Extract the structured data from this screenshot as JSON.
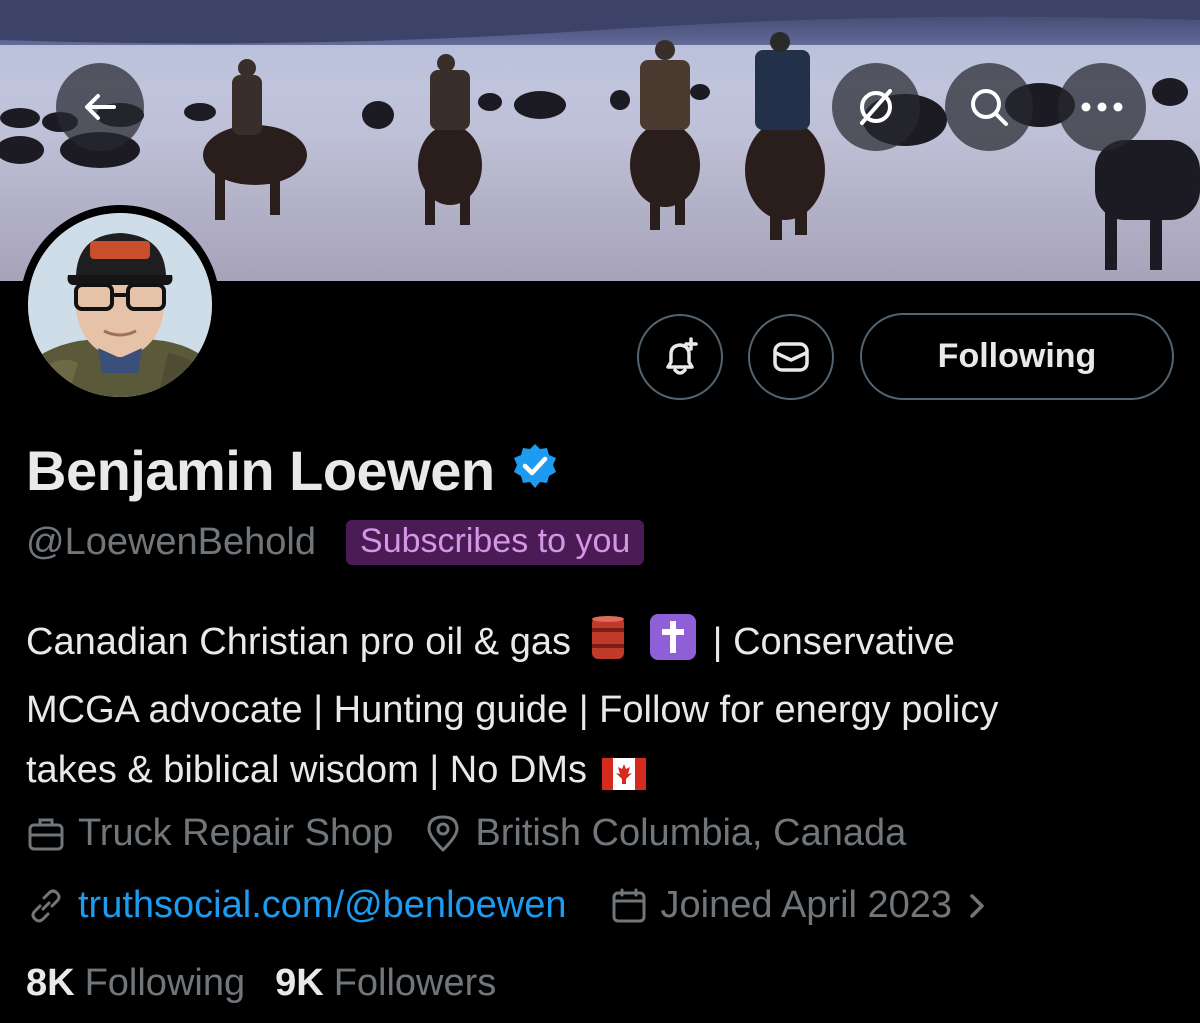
{
  "profile": {
    "name": "Benjamin Loewen",
    "handle": "@LoewenBehold",
    "subscribes_badge": "Subscribes to you",
    "bio": {
      "line1_a": "Canadian Christian pro oil & gas",
      "line1_b": "| Conservative",
      "line2": "MCGA advocate | Hunting guide | Follow for energy policy",
      "line3": "takes & biblical wisdom | No DMs"
    },
    "work": "Truck Repair Shop",
    "location": "British Columbia, Canada",
    "website": "truthsocial.com/@benloewen",
    "joined": "Joined April 2023"
  },
  "actions": {
    "follow_label": "Following"
  },
  "stats": {
    "following_count": "8K",
    "following_label": "Following",
    "followers_count": "9K",
    "followers_label": "Followers"
  },
  "icons": {
    "back": "back-arrow-icon",
    "grok": "grok-icon",
    "search": "search-icon",
    "more": "more-icon",
    "notify": "bell-plus-icon",
    "message": "envelope-icon",
    "verified": "verified-badge-icon",
    "work": "briefcase-icon",
    "location": "location-pin-icon",
    "link": "link-icon",
    "calendar": "calendar-icon",
    "chevron": "chevron-right-icon",
    "oil_barrel": "oil-barrel-emoji",
    "cross": "cross-emoji",
    "canada_flag": "canada-flag-emoji"
  },
  "colors": {
    "background": "#000000",
    "accent": "#1d9bf0",
    "muted": "#71767b",
    "badge_bg": "#4b1b55",
    "badge_text": "#d596e6"
  }
}
